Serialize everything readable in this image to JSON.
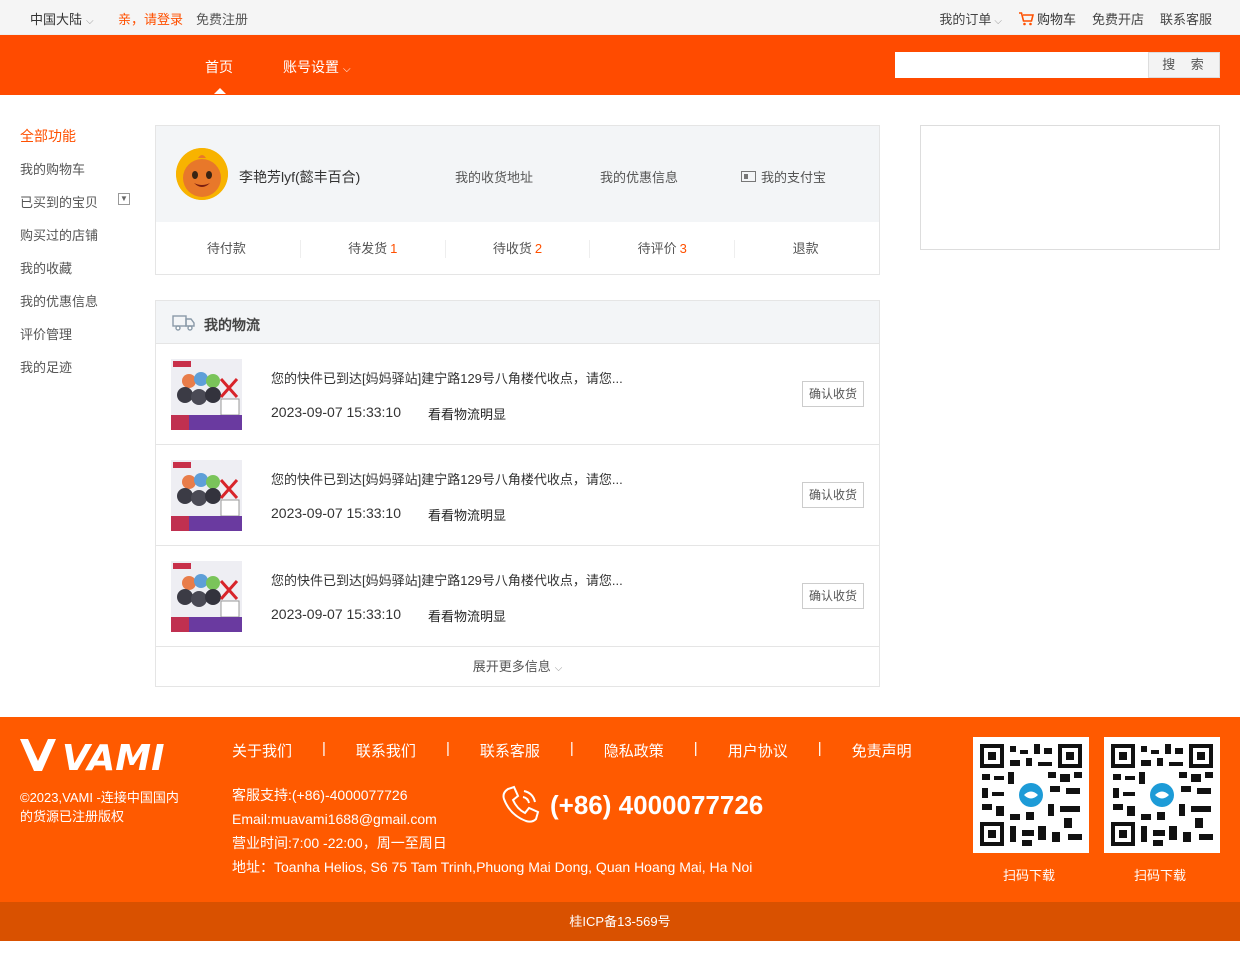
{
  "topbar": {
    "region": "中国大陆",
    "login": "亲，请登录",
    "register": "免费注册",
    "my_orders": "我的订单",
    "cart": "购物车",
    "open_shop": "免费开店",
    "service": "联系客服"
  },
  "nav": {
    "home": "首页",
    "account": "账号设置",
    "search_button": "搜 索",
    "search_value": ""
  },
  "sidebar": {
    "items": [
      {
        "label": "全部功能"
      },
      {
        "label": "我的购物车"
      },
      {
        "label": "已买到的宝贝"
      },
      {
        "label": "购买过的店铺"
      },
      {
        "label": "我的收藏"
      },
      {
        "label": "我的优惠信息"
      },
      {
        "label": "评价管理"
      },
      {
        "label": "我的足迹"
      }
    ]
  },
  "profile": {
    "username": "李艳芳lyf(懿丰百合)",
    "address": "我的收货地址",
    "coupons": "我的优惠信息",
    "alipay": "我的支付宝",
    "orders": [
      {
        "label": "待付款",
        "count": ""
      },
      {
        "label": "待发货",
        "count": "1"
      },
      {
        "label": "待收货",
        "count": "2"
      },
      {
        "label": "待评价",
        "count": "3"
      },
      {
        "label": "退款",
        "count": ""
      }
    ]
  },
  "logistics": {
    "title": "我的物流",
    "rows": [
      {
        "message": "您的快件已到达[妈妈驿站]建宁路129号八角楼代收点，请您...",
        "time": "2023-09-07 15:33:10",
        "track": "看看物流明显",
        "confirm": "确认收货"
      },
      {
        "message": "您的快件已到达[妈妈驿站]建宁路129号八角楼代收点，请您...",
        "time": "2023-09-07 15:33:10",
        "track": "看看物流明显",
        "confirm": "确认收货"
      },
      {
        "message": "您的快件已到达[妈妈驿站]建宁路129号八角楼代收点，请您...",
        "time": "2023-09-07 15:33:10",
        "track": "看看物流明显",
        "confirm": "确认收货"
      }
    ],
    "more": "展开更多信息"
  },
  "footer": {
    "logo": "VAMI",
    "copyright": "©2023,VAMI -连接中国国内的货源已注册版权",
    "links": [
      "关于我们",
      "联系我们",
      "联系客服",
      "隐私政策",
      "用户协议",
      "免责声明"
    ],
    "support": "客服支持:(+86)-4000077726",
    "email": "Email:muavami1688@gmail.com",
    "hours": "营业时间:7:00 -22:00，周一至周日",
    "address": "地址：Toanha Helios, S6 75 Tam Trinh,Phuong Mai Dong, Quan Hoang Mai, Ha Noi",
    "phone": "(+86) 4000077726",
    "qr_caption_1": "扫码下载",
    "qr_caption_2": "扫码下载",
    "icp": "桂ICP备13-569号"
  },
  "colors": {
    "brand": "#ff4b00",
    "footer": "#ff5a00",
    "icp_bar": "#d95100",
    "accent_text": "#ff5000"
  }
}
